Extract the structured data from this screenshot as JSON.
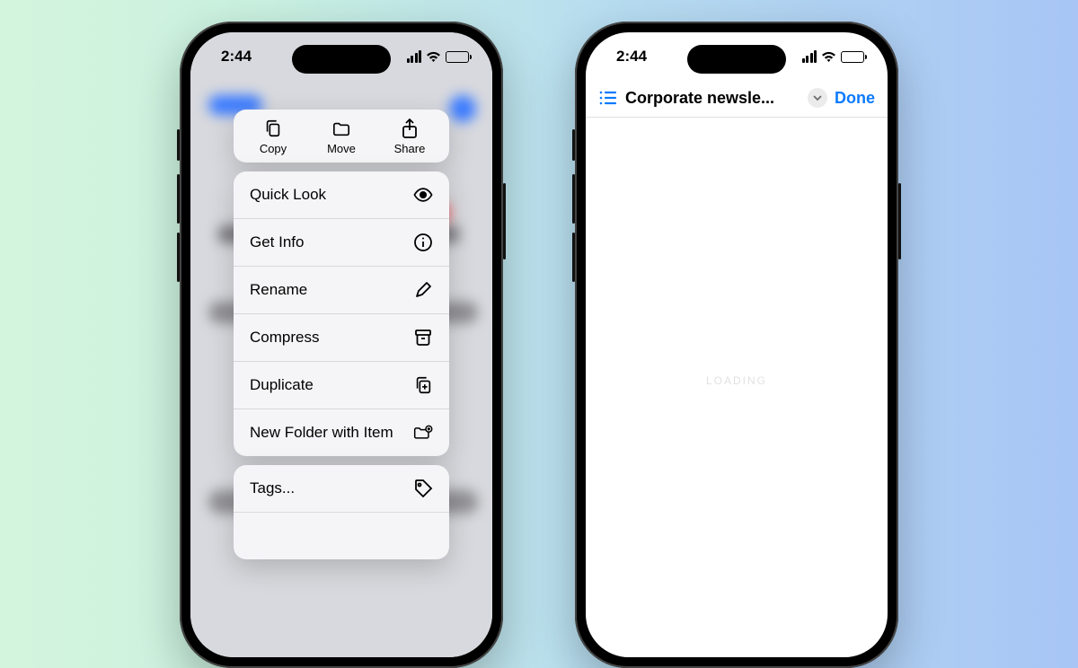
{
  "status": {
    "time": "2:44"
  },
  "colors": {
    "accent": "#0a7aff",
    "battery_fill": "#ffcc00"
  },
  "left_phone": {
    "top_actions": [
      {
        "label": "Copy",
        "icon": "copy-icon"
      },
      {
        "label": "Move",
        "icon": "folder-icon"
      },
      {
        "label": "Share",
        "icon": "share-icon"
      }
    ],
    "menu_items": [
      {
        "label": "Quick Look",
        "icon": "eye-icon"
      },
      {
        "label": "Get Info",
        "icon": "info-icon"
      },
      {
        "label": "Rename",
        "icon": "pencil-icon"
      },
      {
        "label": "Compress",
        "icon": "archive-icon"
      },
      {
        "label": "Duplicate",
        "icon": "duplicate-icon"
      },
      {
        "label": "New Folder with Item",
        "icon": "folder-plus-icon"
      }
    ],
    "menu_items2": [
      {
        "label": "Tags...",
        "icon": "tag-icon"
      }
    ]
  },
  "right_phone": {
    "title": "Corporate newsle...",
    "done_label": "Done",
    "loading_label": "LOADING"
  }
}
